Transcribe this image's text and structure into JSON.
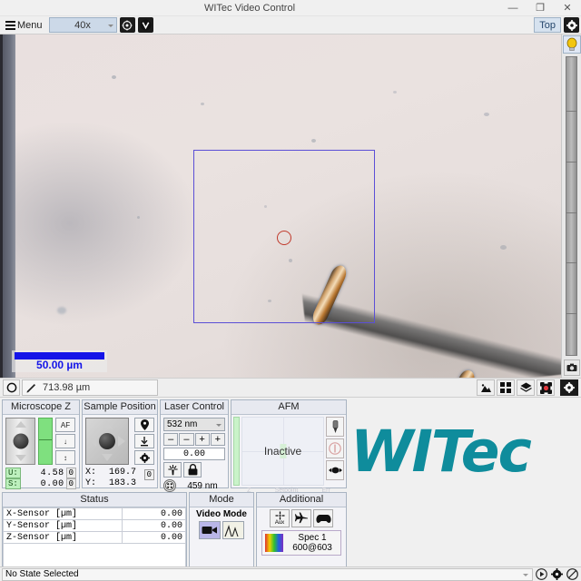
{
  "window": {
    "title": "WITec Video Control",
    "minimize_label": "—",
    "maximize_label": "❐",
    "close_label": "✕"
  },
  "toolbar": {
    "menu_label": "Menu",
    "objective_value": "40x",
    "objective_icon": "target-icon",
    "video_icon": "video-v-icon",
    "top_label": "Top",
    "settings_icon": "gear-icon"
  },
  "video": {
    "scalebar_label": "50.00 µm",
    "lamp_icon": "lamp-icon",
    "camera_icon": "camera-icon"
  },
  "video_status": {
    "shape_icon": "circle-shape-icon",
    "pen_icon": "pen-icon",
    "distance_value": "713.98 µm",
    "icons": [
      {
        "name": "image-icon",
        "glyph": "▲"
      },
      {
        "name": "grid-icon",
        "glyph": "⌗"
      },
      {
        "name": "layers-icon",
        "glyph": "☲"
      },
      {
        "name": "focus-target-icon",
        "glyph": "◉"
      },
      {
        "name": "settings-gear-icon",
        "glyph": "⚙"
      }
    ]
  },
  "microscope_z": {
    "title": "Microscope Z",
    "buttons": [
      {
        "name": "auto-focus-button",
        "label": "AF"
      },
      {
        "name": "move-down-button",
        "label": "↓"
      },
      {
        "name": "range-button",
        "label": "↕"
      }
    ],
    "rows": [
      {
        "tag": "U:",
        "value": "4.58",
        "zero": "0"
      },
      {
        "tag": "S:",
        "value": "0.00",
        "zero": "0"
      }
    ]
  },
  "sample_position": {
    "title": "Sample Position",
    "buttons": [
      {
        "name": "marker-button",
        "label": "●"
      },
      {
        "name": "approach-button",
        "label": "↓"
      },
      {
        "name": "settings-button",
        "label": "⚙"
      }
    ],
    "x_label": "X:",
    "x_value": "169.7",
    "y_label": "Y:",
    "y_value": "183.3",
    "zero_label": "0"
  },
  "laser_control": {
    "title": "Laser Control",
    "wavelength_selected": "532 nm",
    "buttons": [
      "–",
      "–",
      "+",
      "+"
    ],
    "power_value": "0.00",
    "laser_icon": "laser-icon",
    "lock_icon": "lock-icon",
    "spot_icon": "spot-icon",
    "secondary_wavelength": "459 nm"
  },
  "afm": {
    "title": "AFM",
    "state": "Inactive",
    "buttons": [
      {
        "name": "tip-button"
      },
      {
        "name": "feedback-button"
      },
      {
        "name": "move-button"
      }
    ],
    "footer": [
      "Z",
      "Setpoint",
      "Err"
    ]
  },
  "status": {
    "title": "Status",
    "rows": [
      {
        "label": "X-Sensor [µm]",
        "value": "0.00"
      },
      {
        "label": "Y-Sensor [µm]",
        "value": "0.00"
      },
      {
        "label": "Z-Sensor [µm]",
        "value": "0.00"
      }
    ]
  },
  "mode": {
    "title": "Mode",
    "active_label": "Video Mode",
    "video_icon": "video-camera-icon",
    "spectrum_icon": "spectrum-icon"
  },
  "additional": {
    "title": "Additional",
    "aux_label": "Aux",
    "aux_icon": "aux-icon",
    "plane_icon": "airplane-icon",
    "gamepad_icon": "gamepad-icon",
    "spec_icon": "spectrum-color-icon",
    "spec_name": "Spec 1",
    "spec_detail": "600@603"
  },
  "branding": {
    "logo_text": "WITec",
    "logo_color": "#0f8c9c"
  },
  "statusbar": {
    "state_text": "No State Selected",
    "play_icon": "play-icon",
    "gear_icon": "gear-icon",
    "block_icon": "no-entry-icon"
  }
}
